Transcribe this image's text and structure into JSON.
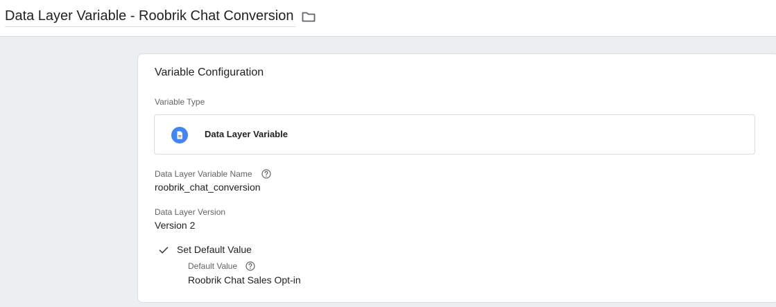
{
  "header": {
    "title": "Data Layer Variable - Roobrik Chat Conversion",
    "folder_icon": "folder-icon"
  },
  "config": {
    "heading": "Variable Configuration",
    "variable_type_label": "Variable Type",
    "variable_type_value": "Data Layer Variable",
    "variable_type_icon": "document-icon",
    "variable_type_icon_color": "#4285f4",
    "dl_name_label": "Data Layer Variable Name",
    "dl_name_value": "roobrik_chat_conversion",
    "dl_version_label": "Data Layer Version",
    "dl_version_value": "Version 2",
    "default_checkbox_label": "Set Default Value",
    "default_checked": true,
    "default_value_label": "Default Value",
    "default_value": "Roobrik Chat Sales Opt-in",
    "help_icon": "help-circle-icon",
    "check_icon": "checkmark-icon"
  }
}
